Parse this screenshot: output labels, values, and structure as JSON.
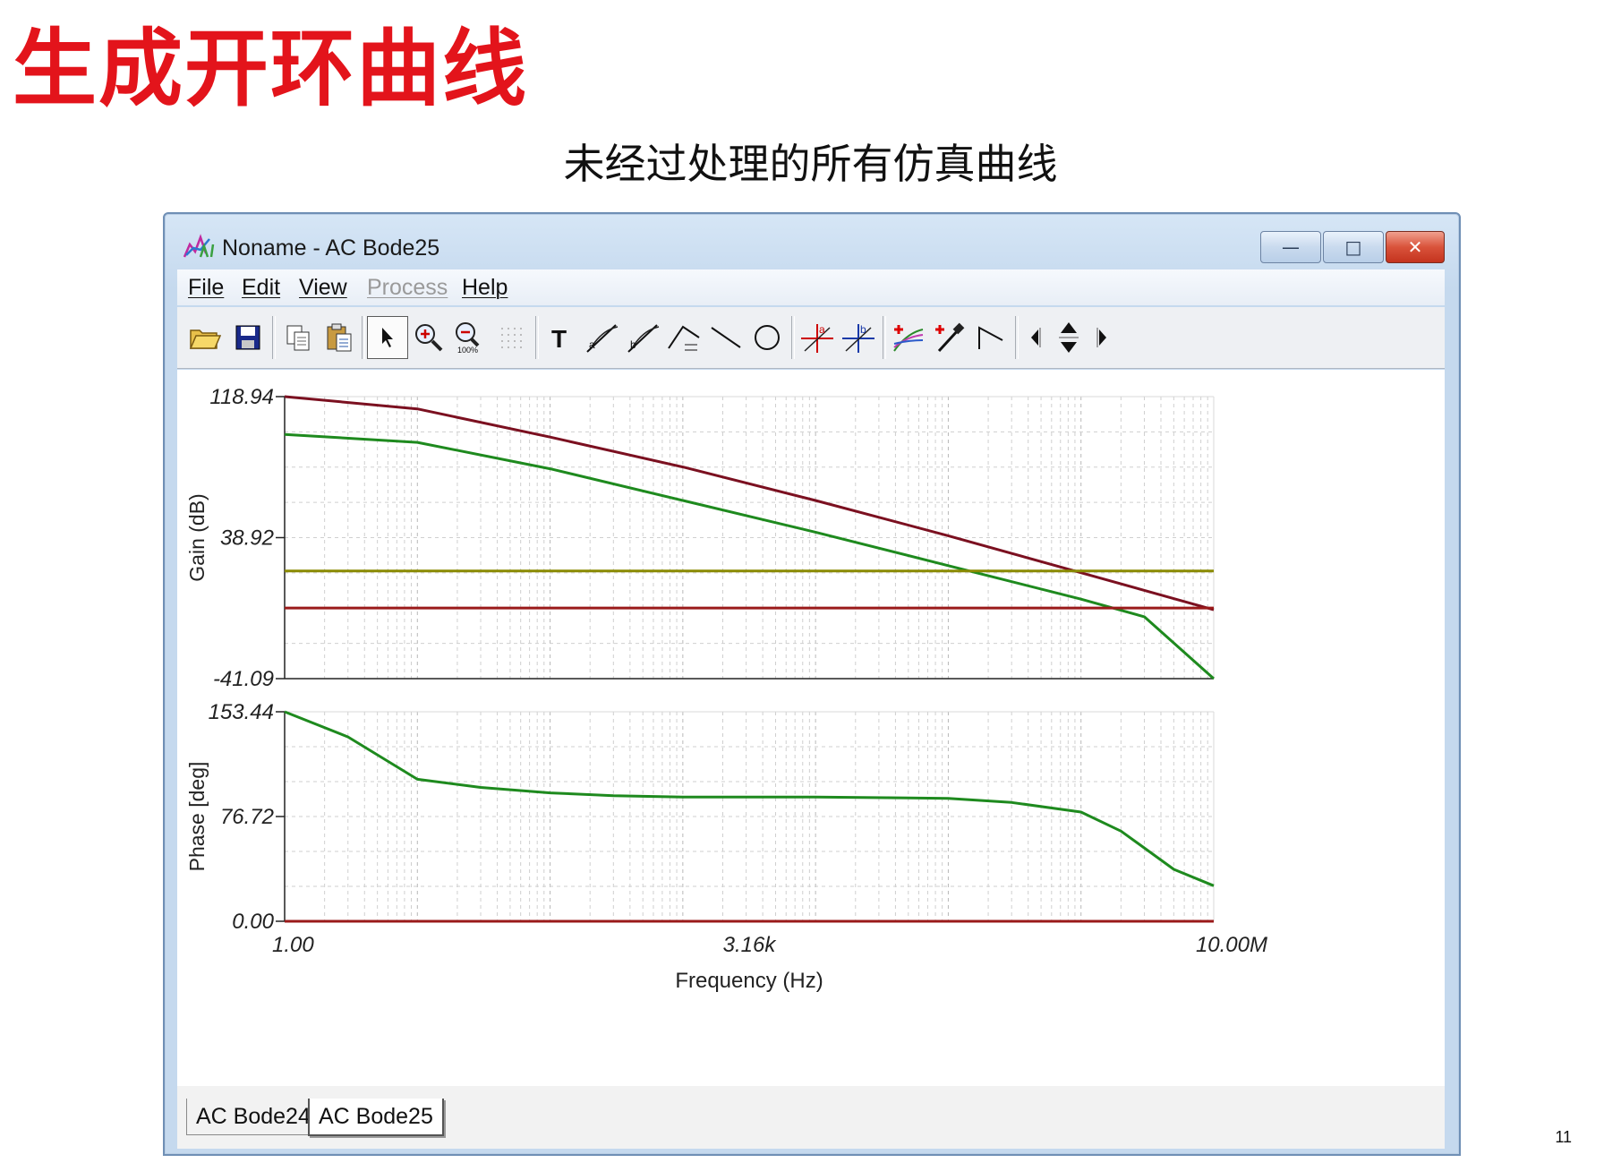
{
  "slide": {
    "title": "生成开环曲线",
    "subtitle": "未经过处理的所有仿真曲线",
    "page_number": "11"
  },
  "window": {
    "title": "Noname - AC Bode25",
    "controls": {
      "minimize": "—",
      "maximize": "□",
      "close": "✕"
    }
  },
  "menu": [
    "File",
    "Edit",
    "View",
    "Process",
    "Help"
  ],
  "menu_disabled": [
    "Process"
  ],
  "toolbar_icons": [
    "open-icon",
    "save-icon",
    "copy-icon",
    "paste-icon",
    "select-arrow-icon",
    "zoom-in-icon",
    "zoom-100-icon",
    "grid-icon",
    "text-icon",
    "cursor-a-icon",
    "cursor-b-icon",
    "cursor-c-icon",
    "line-icon",
    "circle-icon",
    "marker-a-icon",
    "marker-b-icon",
    "add-curve-icon",
    "probe-icon",
    "corner-icon",
    "left-icon",
    "up-down-icon",
    "right-icon"
  ],
  "chart_data": [
    {
      "type": "line",
      "ylabel": "Gain (dB)",
      "xlabel": "Frequency (Hz)",
      "xscale": "log",
      "xlim": [
        1,
        10000000
      ],
      "ylim": [
        -41.09,
        118.94
      ],
      "ytick_labels": [
        "118.94",
        "38.92",
        "-41.09"
      ],
      "grid": true,
      "series": [
        {
          "color": "#7b1020",
          "x": [
            1,
            10,
            100,
            1000,
            10000,
            100000,
            1000000,
            3000000,
            10000000
          ],
          "y": [
            118.94,
            112,
            96,
            79,
            60,
            40,
            19,
            9,
            -2
          ]
        },
        {
          "color": "#1e8a1e",
          "x": [
            1,
            10,
            100,
            1000,
            10000,
            100000,
            1000000,
            3000000,
            10000000
          ],
          "y": [
            97.5,
            93,
            78,
            60,
            42,
            23,
            4,
            -6,
            -41.09
          ]
        },
        {
          "color": "#8a8a00",
          "x": [
            1,
            10000000
          ],
          "y": [
            20,
            20
          ]
        },
        {
          "color": "#9a1a1a",
          "x": [
            1,
            10000000
          ],
          "y": [
            -1,
            -1
          ]
        }
      ]
    },
    {
      "type": "line",
      "ylabel": "Phase [deg]",
      "xlabel": "Frequency (Hz)",
      "xscale": "log",
      "xlim": [
        1,
        10000000
      ],
      "ylim": [
        0,
        153.44
      ],
      "ytick_labels": [
        "153.44",
        "76.72",
        "0.00"
      ],
      "xtick_labels": [
        "1.00",
        "3.16k",
        "10.00M"
      ],
      "grid": true,
      "series": [
        {
          "color": "#1e8a1e",
          "x": [
            1,
            3,
            10,
            30,
            100,
            300,
            1000,
            10000,
            100000,
            300000,
            1000000,
            2000000,
            5000000,
            10000000
          ],
          "y": [
            153.44,
            135,
            104,
            98,
            94,
            92,
            91,
            91,
            90,
            87,
            80,
            66,
            38,
            26
          ]
        },
        {
          "color": "#9a1a1a",
          "x": [
            1,
            10000000
          ],
          "y": [
            0,
            0
          ]
        }
      ]
    }
  ],
  "tabs": [
    {
      "label": "AC Bode24",
      "active": false
    },
    {
      "label": "AC Bode25",
      "active": true
    }
  ]
}
